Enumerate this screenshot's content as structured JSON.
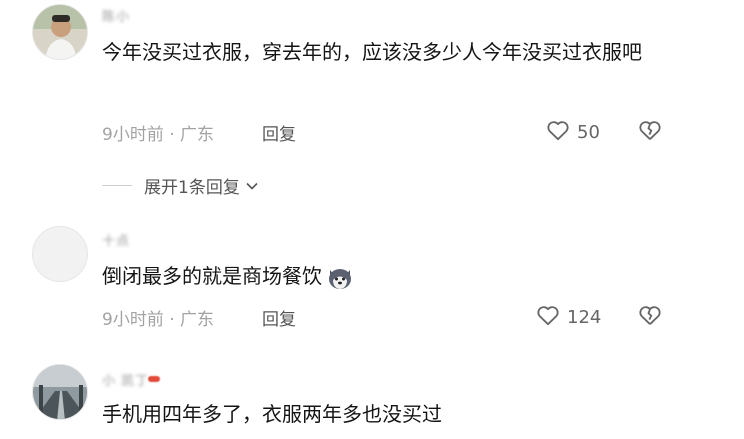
{
  "comments": [
    {
      "username": "陈小",
      "text": "今年没买过衣服，穿去年的，应该没多少人今年没买过衣服吧",
      "time_location": "9小时前 · 广东",
      "reply_label": "回复",
      "likes": "50",
      "expand_label": "展开1条回复"
    },
    {
      "username": "十点",
      "text": "倒闭最多的就是商场餐饮",
      "time_location": "9小时前 · 广东",
      "reply_label": "回复",
      "likes": "124"
    },
    {
      "username": "小 凯丁",
      "text": "手机用四年多了，衣服两年多也没买过"
    }
  ],
  "icons": {
    "like": "heart-outline-icon",
    "dislike": "broken-heart-icon",
    "expand": "chevron-down-icon",
    "emoji": "husky-dog-emoji"
  }
}
